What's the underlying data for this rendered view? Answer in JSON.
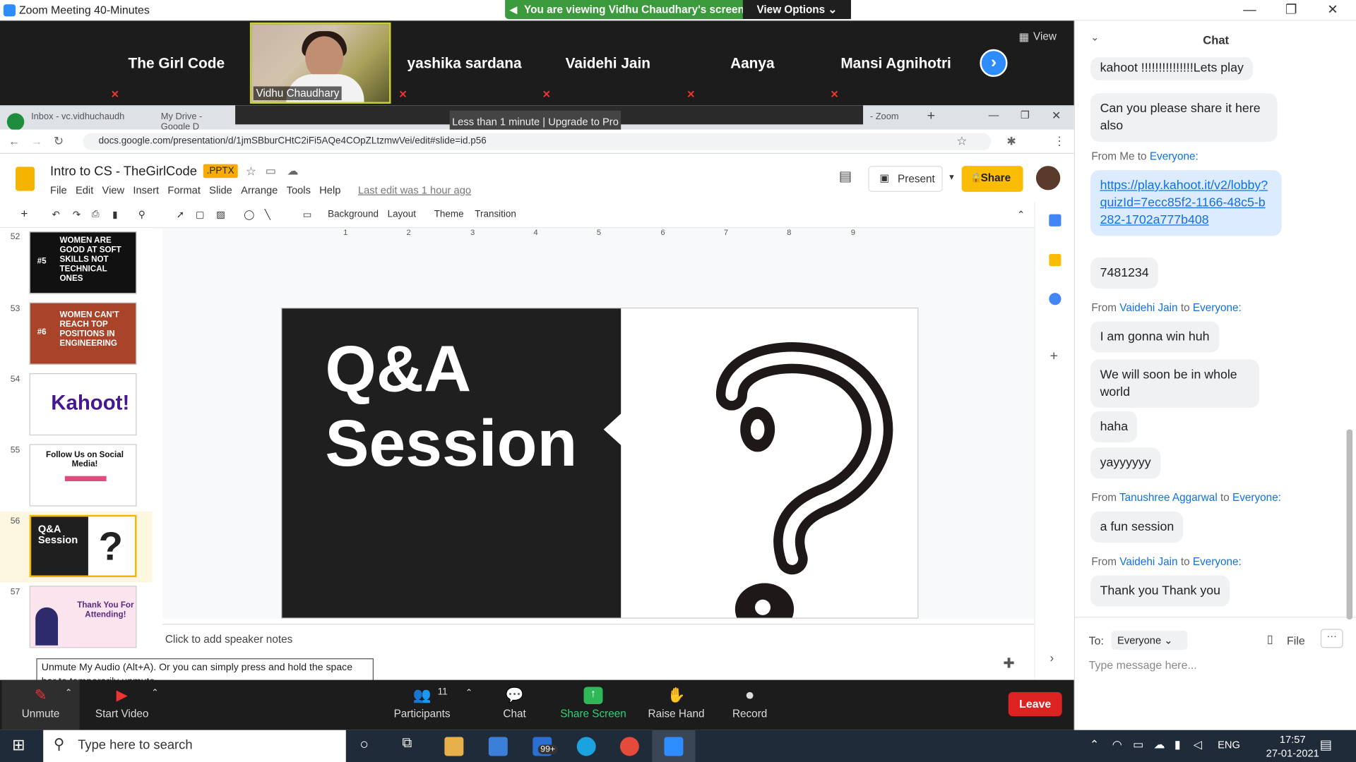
{
  "window": {
    "title": "Zoom Meeting 40-Minutes"
  },
  "banner": {
    "message": "You are viewing Vidhu Chaudhary's screen",
    "view_options": "View Options ⌄"
  },
  "participants": [
    "The Girl Code",
    "Vidhu Chaudhary",
    "yashika sardana",
    "Vaidehi Jain",
    "Aanya",
    "Mansi Agnihotri"
  ],
  "strip_view_label": "View",
  "browser": {
    "tabs": [
      "Inbox - vc.vidhuchaudh",
      "My Drive - Google D",
      "- Zoom"
    ],
    "upgrade_tip": "Less than 1 minute | Upgrade to Pro",
    "url": "docs.google.com/presentation/d/1jmSBburCHtC2iFi5AQe4COpZLtzmwVei/edit#slide=id.p56"
  },
  "slides_app": {
    "doc_title": "Intro to CS - TheGirlCode",
    "badge": ".PPTX",
    "menus": [
      "File",
      "Edit",
      "View",
      "Insert",
      "Format",
      "Slide",
      "Arrange",
      "Tools",
      "Help"
    ],
    "last_edit": "Last edit was 1 hour ago",
    "present": "Present",
    "share": "Share",
    "toolbar": [
      "Background",
      "Layout",
      "Theme",
      "Transition"
    ],
    "ruler_numbers": [
      "1",
      "2",
      "3",
      "4",
      "5",
      "6",
      "7",
      "8",
      "9"
    ],
    "slide_numbers": [
      "52",
      "53",
      "54",
      "55",
      "56",
      "57"
    ],
    "thumbs": {
      "t52": "WOMEN ARE GOOD AT SOFT SKILLS NOT TECHNICAL ONES",
      "t52_num": "#5",
      "t53": "WOMEN CAN'T REACH TOP POSITIONS IN ENGINEERING",
      "t53_num": "#6",
      "t54": "Kahoot!",
      "t55": "Follow Us on Social Media!",
      "t56": "Q&A Session",
      "t57": "Thank You For Attending!"
    },
    "slide_title_line1": "Q&A",
    "slide_title_line2": "Session",
    "notes_placeholder": "Click to add speaker notes"
  },
  "zoom_controls": {
    "unmute": "Unmute",
    "start_video": "Start Video",
    "participants": "Participants",
    "participant_count": "11",
    "chat": "Chat",
    "share_screen": "Share Screen",
    "raise_hand": "Raise Hand",
    "record": "Record",
    "leave": "Leave",
    "tooltip": "Unmute My Audio (Alt+A). Or you can simply press and hold the space bar to temporarily unmute."
  },
  "chat": {
    "title": "Chat",
    "m1": "kahoot !!!!!!!!!!!!!!!Lets play",
    "m2": "Can you please share it here also",
    "from_me": "From Me to",
    "everyone": "Everyone:",
    "link": "https://play.kahoot.it/v2/lobby?quizId=7ecc85f2-1166-48c5-b282-1702a777b408",
    "m4": "7481234",
    "from": "From",
    "to": "to",
    "sender_vaidehi": "Vaidehi Jain",
    "m5": "I am gonna win huh",
    "m6": "We will soon be in whole world",
    "m7": "haha",
    "m8": "yayyyyyy",
    "sender_tanushree": "Tanushree Aggarwal",
    "m9": "a fun session",
    "m10": "Thank you Thank you",
    "to_label": "To:",
    "recipient": "Everyone",
    "file": "File",
    "placeholder": "Type message here..."
  },
  "taskbar": {
    "search_placeholder": "Type here to search",
    "mail_badge": "99+",
    "lang": "ENG",
    "time": "17:57",
    "date": "27-01-2021"
  }
}
